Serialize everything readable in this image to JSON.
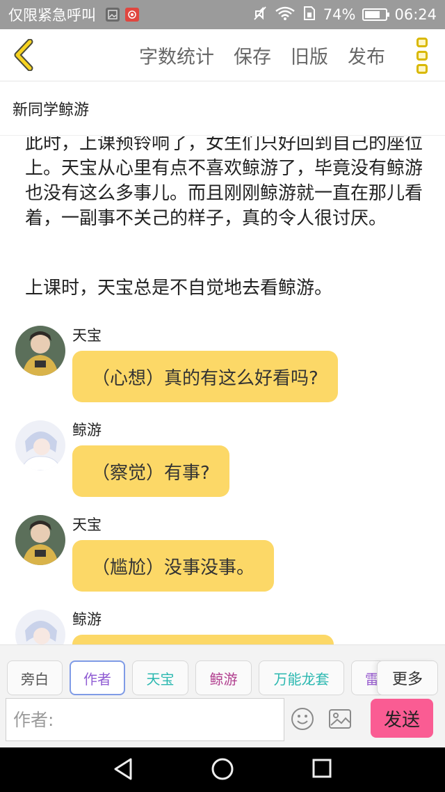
{
  "status_bar": {
    "carrier": "仅限紧急呼叫",
    "battery": "74%",
    "battery_level": 0.74,
    "time": "06:24"
  },
  "toolbar": {
    "back_icon": "chevron-left-icon",
    "actions": [
      "字数统计",
      "保存",
      "旧版",
      "发布"
    ],
    "menu_icon": "more-vertical-icon",
    "accent_color": "#d9b800"
  },
  "chapter": {
    "title": "新同学鲸游"
  },
  "content": {
    "paragraphs": [
      "此时，上课预铃响了，女生们只好回到自己的座位上。天宝从心里有点不喜欢鲸游了，毕竟没有鲸游也没有这么多事儿。而且刚刚鲸游就一直在那儿看着，一副事不关己的样子，真的令人很讨厌。",
      "上课时，天宝总是不自觉地去看鲸游。"
    ],
    "messages": [
      {
        "speaker": "天宝",
        "text": "（心想）真的有这么好看吗?"
      },
      {
        "speaker": "鲸游",
        "text": "（察觉）有事?"
      },
      {
        "speaker": "天宝",
        "text": "（尴尬）没事没事。"
      },
      {
        "speaker": "鲸游",
        "text": ""
      }
    ],
    "bubble_color": "#fcd867"
  },
  "roles": {
    "chips": [
      {
        "label": "旁白",
        "color": "#555555"
      },
      {
        "label": "作者",
        "color": "#8f5bd3"
      },
      {
        "label": "天宝",
        "color": "#2bb8b0"
      },
      {
        "label": "鲸游",
        "color": "#b13f8f"
      },
      {
        "label": "万能龙套",
        "color": "#2bb8b0"
      },
      {
        "label": "雷",
        "color": "#9a5fd0"
      }
    ],
    "more_label": "更多"
  },
  "composer": {
    "placeholder": "作者:",
    "emoji_icon": "emoji-icon",
    "image_icon": "image-icon",
    "send_label": "发送",
    "send_color": "#fa5c93"
  },
  "nav_bar": {
    "icons": [
      "back-triangle-icon",
      "home-circle-icon",
      "recent-square-icon"
    ]
  }
}
